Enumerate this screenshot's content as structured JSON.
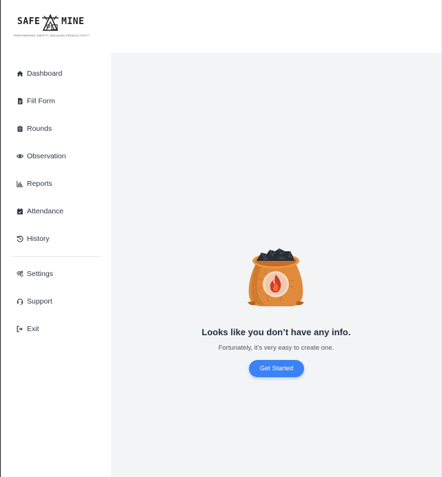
{
  "brand": {
    "name_left": "SAFE",
    "name_right": "MINE",
    "tagline": "\"EMPOWERING SAFETY, BUILDING PRODUCTIVITY\""
  },
  "sidebar": {
    "items": [
      {
        "label": "Dashboard",
        "icon": "home-icon"
      },
      {
        "label": "Fill Form",
        "icon": "file-icon"
      },
      {
        "label": "Rounds",
        "icon": "clipboard-icon"
      },
      {
        "label": "Observation",
        "icon": "eye-icon"
      },
      {
        "label": "Reports",
        "icon": "bar-chart-icon"
      },
      {
        "label": "Attendance",
        "icon": "calendar-check-icon"
      },
      {
        "label": "History",
        "icon": "history-icon"
      }
    ],
    "secondary": [
      {
        "label": "Settings",
        "icon": "gears-icon"
      },
      {
        "label": "Support",
        "icon": "headset-icon"
      },
      {
        "label": "Exit",
        "icon": "sign-out-icon"
      }
    ]
  },
  "empty_state": {
    "title": "Looks like you don’t have any info.",
    "subtitle": "Fortunately, it’s very easy to create one.",
    "button_label": "Get Started"
  },
  "colors": {
    "accent": "#3b82f6",
    "main_bg": "#f3f4f6",
    "sack": "#e08a3c",
    "flame": "#d23a26"
  }
}
